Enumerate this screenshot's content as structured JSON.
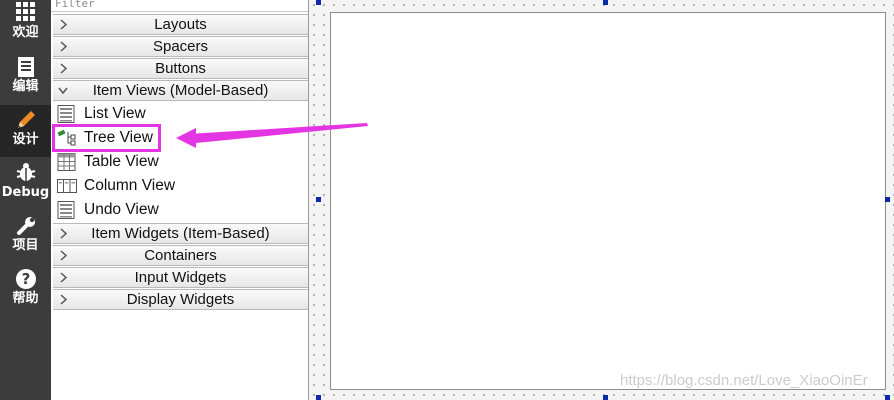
{
  "mode_bar": {
    "items": [
      {
        "label": "欢迎",
        "icon": "grid-icon"
      },
      {
        "label": "编辑",
        "icon": "document-icon"
      },
      {
        "label": "设计",
        "icon": "pencil-icon",
        "active": true
      },
      {
        "label": "Debug",
        "icon": "bug-icon"
      },
      {
        "label": "项目",
        "icon": "wrench-icon"
      },
      {
        "label": "帮助",
        "icon": "help-icon"
      }
    ]
  },
  "widget_box": {
    "filter_placeholder": "Filter",
    "categories": {
      "layouts": "Layouts",
      "spacers": "Spacers",
      "buttons": "Buttons",
      "item_views": "Item Views (Model-Based)",
      "item_widgets": "Item Widgets (Item-Based)",
      "containers": "Containers",
      "input_widgets": "Input Widgets",
      "display_widgets": "Display Widgets"
    },
    "item_views_items": [
      {
        "label": "List View",
        "icon": "list-view-icon"
      },
      {
        "label": "Tree View",
        "icon": "tree-view-icon"
      },
      {
        "label": "Table View",
        "icon": "table-view-icon"
      },
      {
        "label": "Column View",
        "icon": "column-view-icon"
      },
      {
        "label": "Undo View",
        "icon": "undo-view-icon"
      }
    ]
  },
  "annotation": {
    "color": "#e335e3",
    "target": "Tree View"
  },
  "watermark": "https://blog.csdn.net/Love_XiaoOinEr",
  "colors": {
    "mode_bar_bg": "#3c3c3c",
    "mode_active_bg": "#262626",
    "selection_handle": "#0c2aa8"
  }
}
